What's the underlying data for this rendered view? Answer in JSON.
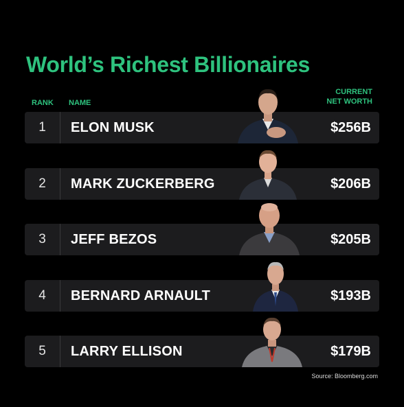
{
  "title": "World’s Richest Billionaires",
  "chart_data": {
    "type": "table",
    "columns": {
      "rank": "RANK",
      "name": "NAME",
      "worth_line1": "CURRENT",
      "worth_line2": "NET WORTH"
    },
    "rows": [
      {
        "rank": "1",
        "name": "ELON MUSK",
        "net_worth_label": "$256B",
        "net_worth": 256
      },
      {
        "rank": "2",
        "name": "MARK ZUCKERBERG",
        "net_worth_label": "$206B",
        "net_worth": 206
      },
      {
        "rank": "3",
        "name": "JEFF BEZOS",
        "net_worth_label": "$205B",
        "net_worth": 205
      },
      {
        "rank": "4",
        "name": "BERNARD ARNAULT",
        "net_worth_label": "$193B",
        "net_worth": 193
      },
      {
        "rank": "5",
        "name": "LARRY ELLISON",
        "net_worth_label": "$179B",
        "net_worth": 179
      }
    ],
    "unit": "billions USD"
  },
  "source": "Source: Bloomberg.com",
  "colors": {
    "accent": "#2ec27e",
    "row_bg": "#1c1c1e",
    "background": "#000000"
  },
  "icons": [
    "person-photo-icon"
  ]
}
